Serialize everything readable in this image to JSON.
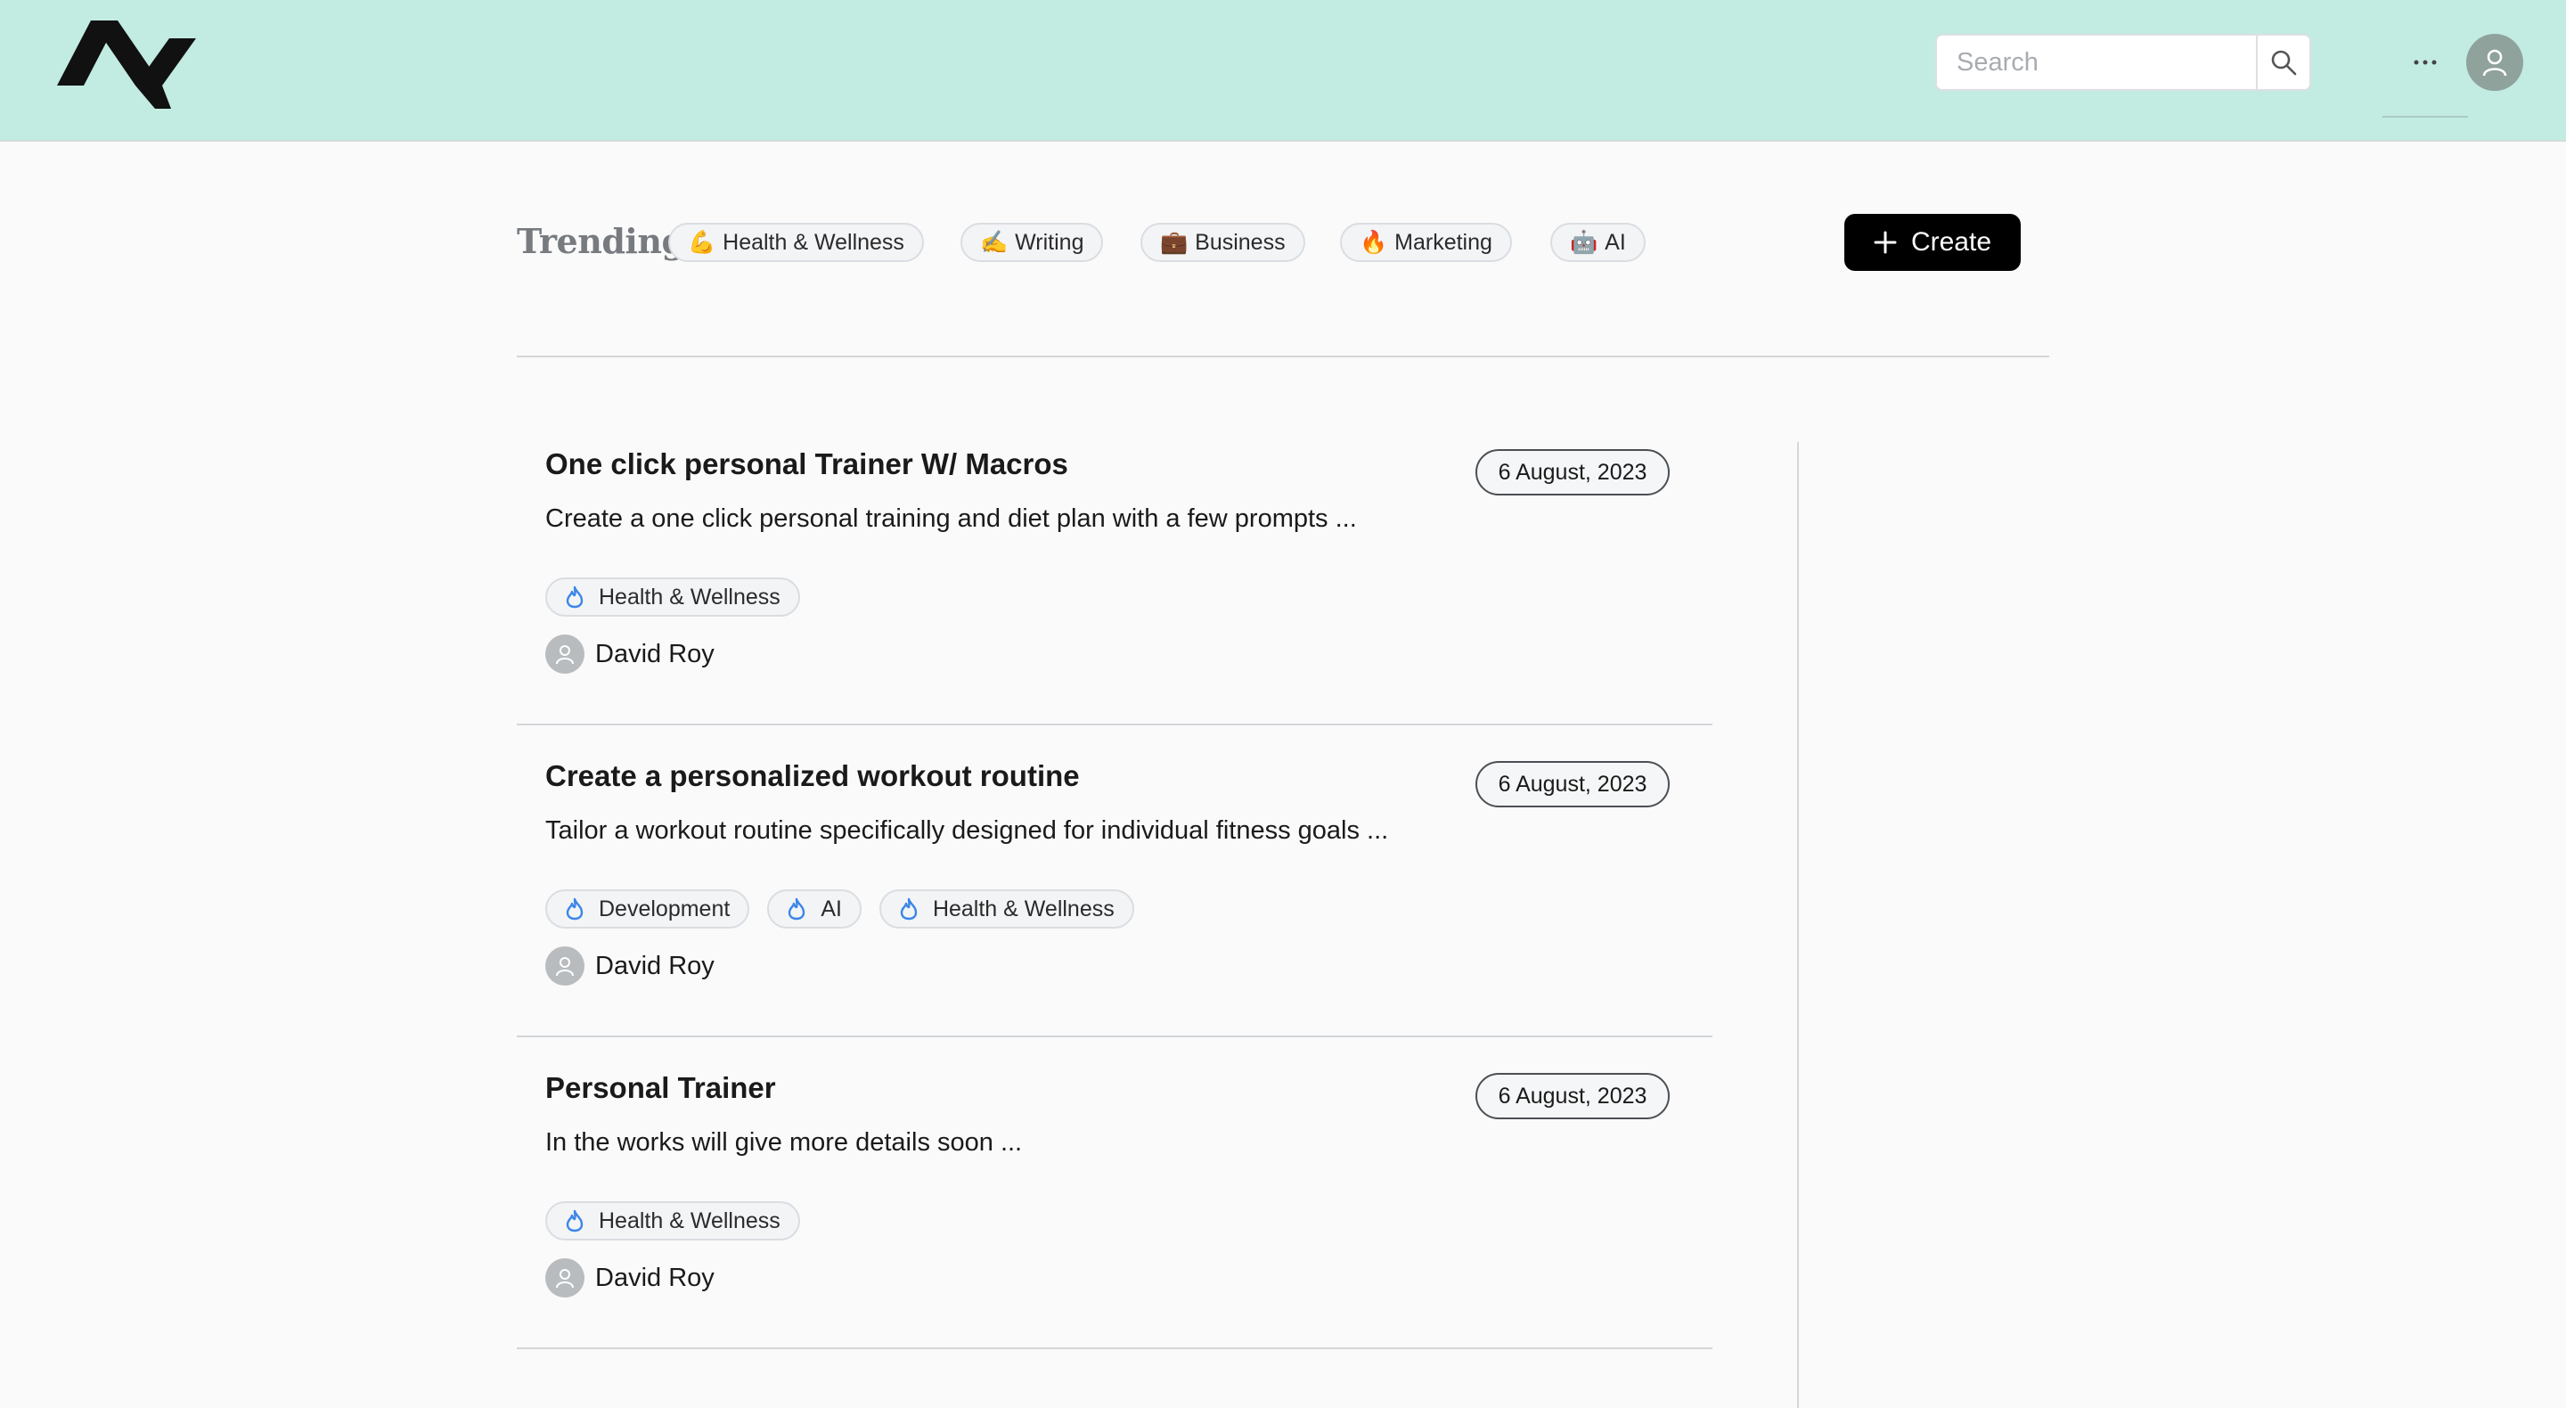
{
  "header": {
    "logo_icon": "zigzag-logo",
    "search": {
      "placeholder": "Search",
      "value": "",
      "icon": "search-icon"
    },
    "more_label": "···",
    "avatar_icon": "user-icon"
  },
  "trending": {
    "label": "Trending",
    "chips": [
      {
        "emoji": "💪",
        "label": "Health & Wellness"
      },
      {
        "emoji": "✍️",
        "label": "Writing"
      },
      {
        "emoji": "💼",
        "label": "Business"
      },
      {
        "emoji": "🔥",
        "label": "Marketing"
      },
      {
        "emoji": "🤖",
        "label": "AI"
      }
    ],
    "create_label": "Create",
    "create_icon": "plus-icon"
  },
  "posts": [
    {
      "title": "One click personal Trainer W/ Macros",
      "date": "6 August, 2023",
      "description": "Create a one click personal training and diet plan with a few prompts ...",
      "tags": [
        "Health & Wellness"
      ],
      "author": "David Roy"
    },
    {
      "title": "Create a personalized workout routine",
      "date": "6 August, 2023",
      "description": "Tailor a workout routine specifically designed for individual fitness goals ...",
      "tags": [
        "Development",
        "AI",
        "Health & Wellness"
      ],
      "author": "David Roy"
    },
    {
      "title": "Personal Trainer",
      "date": "6 August, 2023",
      "description": "In the works will give more details soon ...",
      "tags": [
        "Health & Wellness"
      ],
      "author": "David Roy"
    }
  ],
  "colors": {
    "header_bg": "#c2ebe1",
    "tag_icon": "#3a86e8",
    "create_bg": "#000000"
  }
}
